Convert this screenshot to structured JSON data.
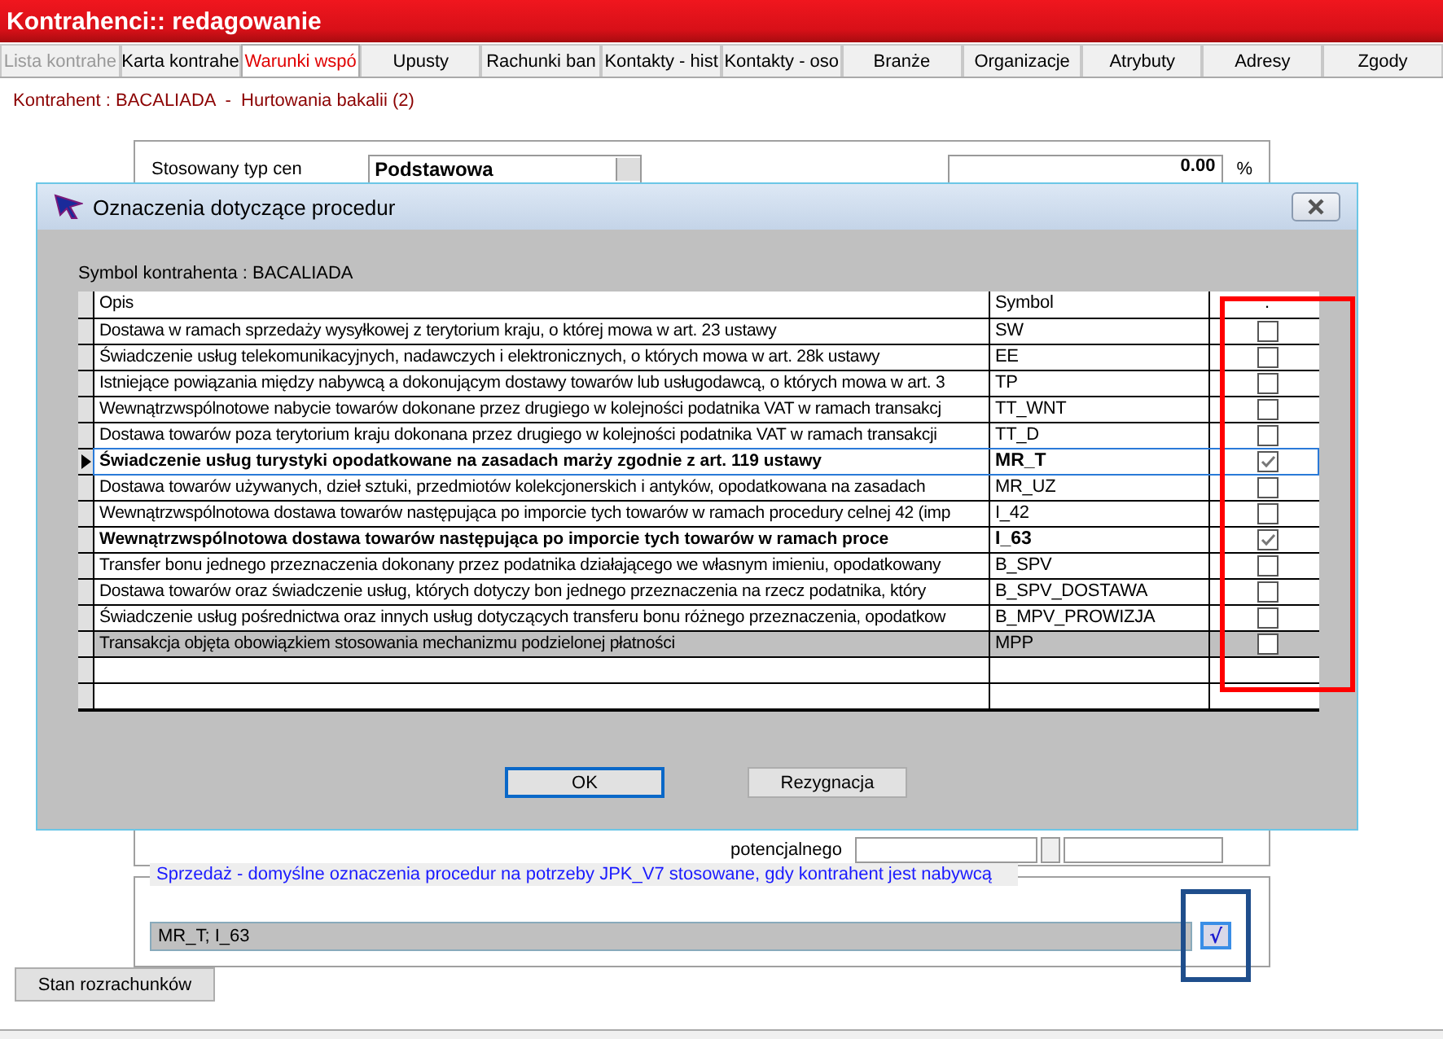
{
  "window": {
    "title": "Kontrahenci:: redagowanie"
  },
  "tabs": [
    {
      "label": "Lista kontrahe",
      "selected": false,
      "disabled": true
    },
    {
      "label": "Karta kontrahe",
      "selected": false,
      "disabled": false
    },
    {
      "label": "Warunki wspó",
      "selected": true,
      "disabled": false
    },
    {
      "label": "Upusty",
      "selected": false,
      "disabled": false
    },
    {
      "label": "Rachunki ban",
      "selected": false,
      "disabled": false
    },
    {
      "label": "Kontakty - hist",
      "selected": false,
      "disabled": false
    },
    {
      "label": "Kontakty - oso",
      "selected": false,
      "disabled": false
    },
    {
      "label": "Branże",
      "selected": false,
      "disabled": false
    },
    {
      "label": "Organizacje",
      "selected": false,
      "disabled": false
    },
    {
      "label": "Atrybuty",
      "selected": false,
      "disabled": false
    },
    {
      "label": "Adresy",
      "selected": false,
      "disabled": false
    },
    {
      "label": "Zgody",
      "selected": false,
      "disabled": false
    }
  ],
  "contractor_line": "Kontrahent : BACALIADA  -  Hurtowania bakalii (2)",
  "form": {
    "price_type_label": "Stosowany typ cen",
    "price_type_value": "Podstawowa",
    "percent_value": "0.00",
    "percent_unit": "%",
    "potential_label": "potencjalnego"
  },
  "dialog": {
    "title": "Oznaczenia dotyczące procedur",
    "symbol_line": "Symbol kontrahenta : BACALIADA",
    "columns": [
      "Opis",
      "Symbol",
      "."
    ],
    "rows": [
      {
        "description": "Dostawa w ramach sprzedaży wysyłkowej z terytorium kraju, o której mowa w art. 23 ustawy",
        "symbol": "SW",
        "checked": false,
        "current": false,
        "selected": false
      },
      {
        "description": "Świadczenie usług telekomunikacyjnych, nadawczych i elektronicznych, o których mowa w art. 28k ustawy",
        "symbol": "EE",
        "checked": false,
        "current": false,
        "selected": false
      },
      {
        "description": "Istniejące powiązania między nabywcą a dokonującym dostawy towarów lub usługodawcą, o których mowa w art. 3",
        "symbol": "TP",
        "checked": false,
        "current": false,
        "selected": false
      },
      {
        "description": "Wewnątrzwspólnotowe nabycie towarów dokonane przez drugiego w kolejności podatnika VAT w ramach transakcj",
        "symbol": "TT_WNT",
        "checked": false,
        "current": false,
        "selected": false
      },
      {
        "description": "Dostawa towarów poza terytorium kraju dokonana przez drugiego w kolejności podatnika VAT w ramach transakcji",
        "symbol": "TT_D",
        "checked": false,
        "current": false,
        "selected": false
      },
      {
        "description": "Świadczenie usług turystyki opodatkowane na zasadach marży zgodnie z art. 119 ustawy",
        "symbol": "MR_T",
        "checked": true,
        "current": true,
        "selected": false
      },
      {
        "description": "Dostawa towarów używanych, dzieł sztuki, przedmiotów kolekcjonerskich i antyków, opodatkowana na zasadach",
        "symbol": "MR_UZ",
        "checked": false,
        "current": false,
        "selected": false
      },
      {
        "description": "Wewnątrzwspólnotowa dostawa towarów następująca po imporcie tych towarów w ramach procedury celnej 42 (imp",
        "symbol": "I_42",
        "checked": false,
        "current": false,
        "selected": false
      },
      {
        "description": "Wewnątrzwspólnotowa dostawa towarów następująca po imporcie tych towarów w ramach proce",
        "symbol": "I_63",
        "checked": true,
        "current": false,
        "selected": false
      },
      {
        "description": "Transfer bonu jednego przeznaczenia dokonany przez podatnika działającego we własnym imieniu, opodatkowany",
        "symbol": "B_SPV",
        "checked": false,
        "current": false,
        "selected": false
      },
      {
        "description": "Dostawa towarów oraz świadczenie usług, których dotyczy bon jednego przeznaczenia na rzecz podatnika, który",
        "symbol": "B_SPV_DOSTAWA",
        "checked": false,
        "current": false,
        "selected": false
      },
      {
        "description": "Świadczenie usług pośrednictwa oraz innych usług dotyczących transferu bonu różnego przeznaczenia, opodatkow",
        "symbol": "B_MPV_PROWIZJA",
        "checked": false,
        "current": false,
        "selected": false
      },
      {
        "description": "Transakcja objęta obowiązkiem stosowania mechanizmu podzielonej płatności",
        "symbol": "MPP",
        "checked": false,
        "current": false,
        "selected": true
      }
    ],
    "buttons": [
      {
        "label": "OK",
        "default": true
      },
      {
        "label": "Rezygnacja",
        "default": false
      }
    ]
  },
  "sales_group": {
    "legend": "Sprzedaż - domyślne oznaczenia procedur na potrzeby JPK_V7 stosowane, gdy kontrahent jest nabywcą",
    "value": "MR_T; I_63",
    "button_label": "√"
  },
  "settlements_button": "Stan rozrachunków"
}
